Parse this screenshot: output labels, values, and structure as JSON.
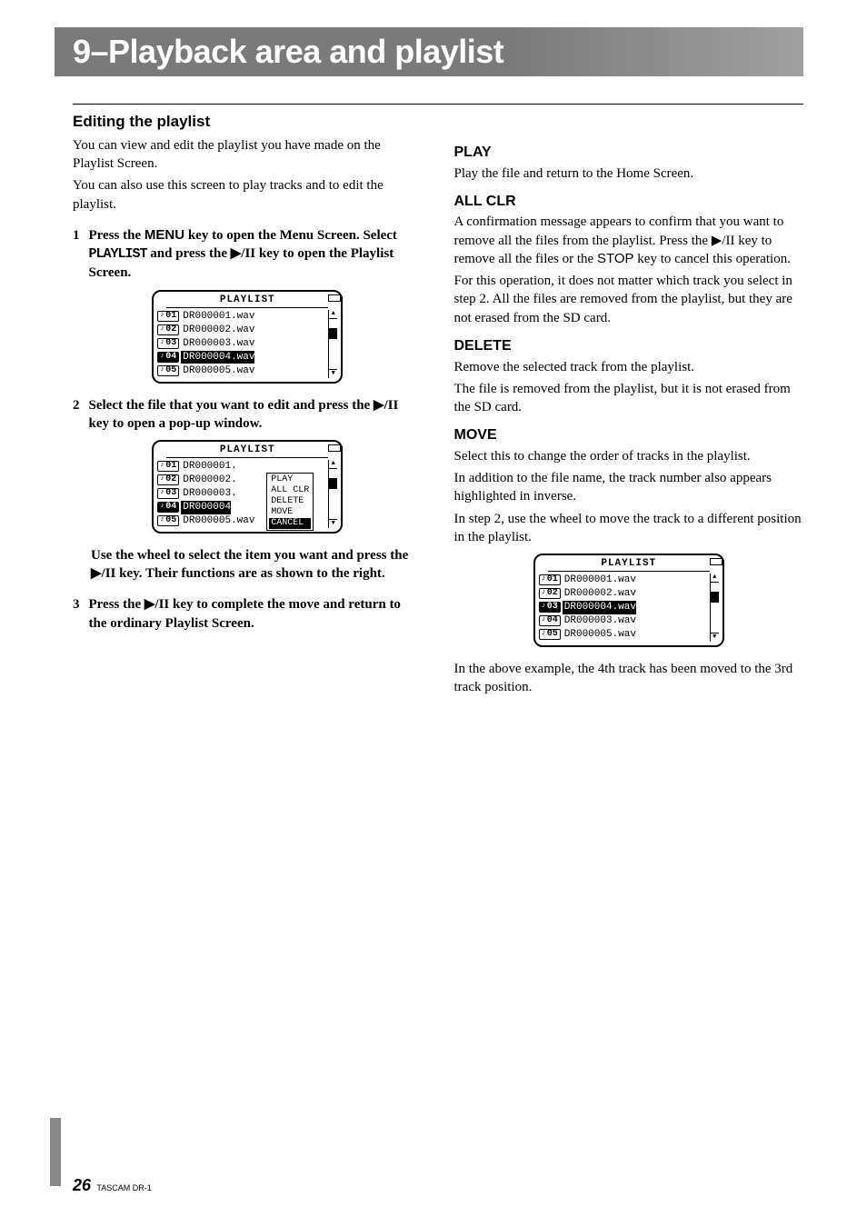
{
  "chapter_title": "9–Playback area and playlist",
  "section_title": "Editing the playlist",
  "intro_p1": "You can view and edit the playlist you have made on the Playlist Screen.",
  "intro_p2": "You can also use this screen to play tracks and to edit the playlist.",
  "step1_num": "1",
  "step1_a": "Press the ",
  "step1_menu": "MENU",
  "step1_b": " key to open the Menu Screen. Select ",
  "step1_playlist": "PLAYLIST",
  "step1_c": " and press the ▶/II key to open the Playlist Screen.",
  "lcd1": {
    "title": "PLAYLIST",
    "rows": [
      {
        "num": "01",
        "file": "DR000001.wav",
        "sel": false,
        "numinv": false
      },
      {
        "num": "02",
        "file": "DR000002.wav",
        "sel": false,
        "numinv": false
      },
      {
        "num": "03",
        "file": "DR000003.wav",
        "sel": false,
        "numinv": false
      },
      {
        "num": "04",
        "file": "DR000004.wav",
        "sel": true,
        "numinv": true
      },
      {
        "num": "05",
        "file": "DR000005.wav",
        "sel": false,
        "numinv": false
      }
    ]
  },
  "step2_num": "2",
  "step2_text": "Select the file that you want to edit and press the ▶/II key to open a pop-up window.",
  "lcd2": {
    "title": "PLAYLIST",
    "rows": [
      {
        "num": "01",
        "file": "DR000001.",
        "sel": false,
        "numinv": false
      },
      {
        "num": "02",
        "file": "DR000002.",
        "sel": false,
        "numinv": false
      },
      {
        "num": "03",
        "file": "DR000003.",
        "sel": false,
        "numinv": false
      },
      {
        "num": "04",
        "file": "DR000004",
        "sel": true,
        "numinv": true
      },
      {
        "num": "05",
        "file": "DR000005.wav",
        "sel": false,
        "numinv": false
      }
    ],
    "popup": [
      "PLAY",
      "ALL CLR",
      "DELETE",
      "MOVE",
      "CANCEL"
    ]
  },
  "step2_after": "Use the wheel to select the item you want and press the ▶/II key. Their functions are as shown to the right.",
  "step3_num": "3",
  "step3_text": "Press the ▶/II key to complete the move and return to the ordinary Playlist Screen.",
  "right": {
    "play_h": "PLAY",
    "play_p": "Play the file and return to the Home Screen.",
    "allclr_h": "ALL CLR",
    "allclr_p1a": "A confirmation message appears to confirm that you want to remove all the files from the playlist. Press the ▶/II key to remove all the files or the ",
    "allclr_stop": "STOP",
    "allclr_p1b": " key to cancel this operation.",
    "allclr_p2": "For this operation, it does not matter which track you select in step 2. All the files are removed from the playlist, but they are not erased from the SD card.",
    "delete_h": "DELETE",
    "delete_p1": "Remove the selected track from the playlist.",
    "delete_p2": "The file is removed from the playlist, but it is not erased from the SD card.",
    "move_h": "MOVE",
    "move_p1": "Select this to change the order of tracks in the playlist.",
    "move_p2": "In addition to the file name, the track number also appears highlighted in inverse.",
    "move_p3": "In step 2, use the wheel to move the track to a different position in the playlist.",
    "move_after": "In the above example, the 4th track has been moved to the 3rd track position."
  },
  "lcd3": {
    "title": "PLAYLIST",
    "rows": [
      {
        "num": "01",
        "file": "DR000001.wav",
        "sel": false,
        "numinv": false
      },
      {
        "num": "02",
        "file": "DR000002.wav",
        "sel": false,
        "numinv": false
      },
      {
        "num": "03",
        "file": "DR000004.wav",
        "sel": true,
        "numinv": true
      },
      {
        "num": "04",
        "file": "DR000003.wav",
        "sel": false,
        "numinv": false
      },
      {
        "num": "05",
        "file": "DR000005.wav",
        "sel": false,
        "numinv": false
      }
    ]
  },
  "footer": {
    "page": "26",
    "model": "TASCAM DR-1"
  }
}
